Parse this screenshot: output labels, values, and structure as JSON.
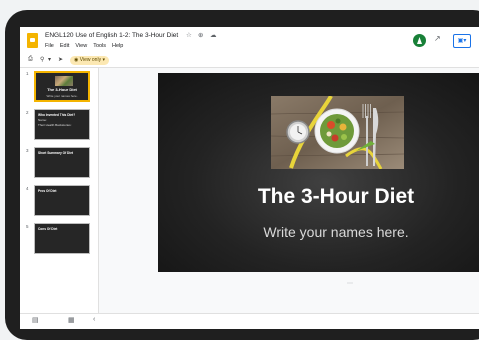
{
  "document": {
    "title": "ENGL120 Use of English 1-2: The 3-Hour Diet",
    "star_icon": "star-icon",
    "move_icon": "folder-icon",
    "cloud_icon": "cloud-icon"
  },
  "menu": [
    "File",
    "Edit",
    "View",
    "Tools",
    "Help"
  ],
  "account": {
    "avatar_letter": ""
  },
  "toolbar": {
    "view_only_label": "View only"
  },
  "slides": [
    {
      "number": "1",
      "title": "The 3-Hour Diet",
      "subtitle": "Write your names here."
    },
    {
      "number": "2",
      "title": "Who Invented This Diet?",
      "lines": [
        "Name:",
        "Their Health Backstories:"
      ]
    },
    {
      "number": "3",
      "title": "Short Summary Of Diet"
    },
    {
      "number": "4",
      "title": "Pros Of Diet"
    },
    {
      "number": "5",
      "title": "Cons Of Diet"
    }
  ],
  "main_slide": {
    "title": "The 3-Hour Diet",
    "subtitle": "Write your names here."
  },
  "colors": {
    "accent": "#f4b400",
    "avatar": "#188038",
    "present": "#1a73e8"
  }
}
